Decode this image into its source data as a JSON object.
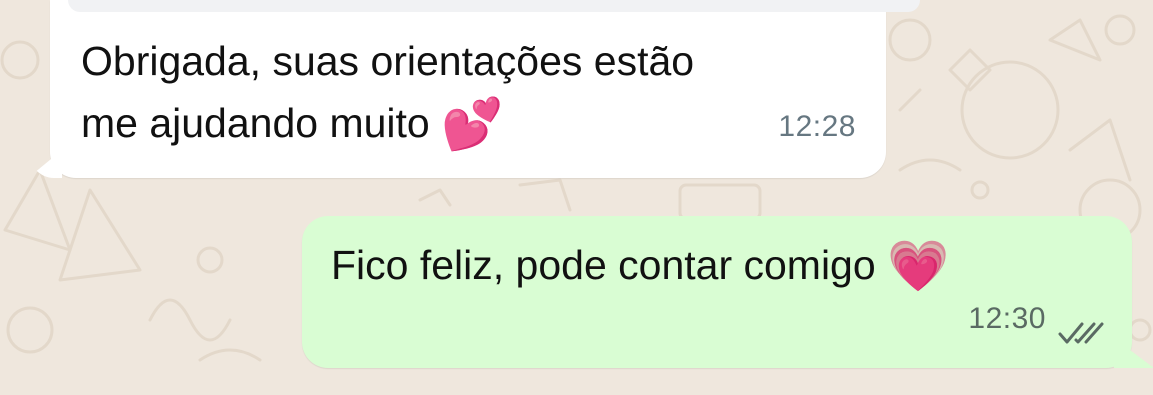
{
  "messages": {
    "incoming": {
      "line1": "Obrigada, suas orientações estão",
      "line2": "me ajudando muito",
      "emoji": "💕",
      "time": "12:28"
    },
    "outgoing": {
      "text": "Fico feliz, pode contar comigo",
      "emoji": "💗",
      "time": "12:30",
      "status_icon": "double-check-icon"
    }
  },
  "colors": {
    "background": "#efe7dd",
    "incoming_bubble": "#ffffff",
    "outgoing_bubble": "#d9fdd3",
    "timestamp": "#667781",
    "heart": "#f0307d"
  }
}
